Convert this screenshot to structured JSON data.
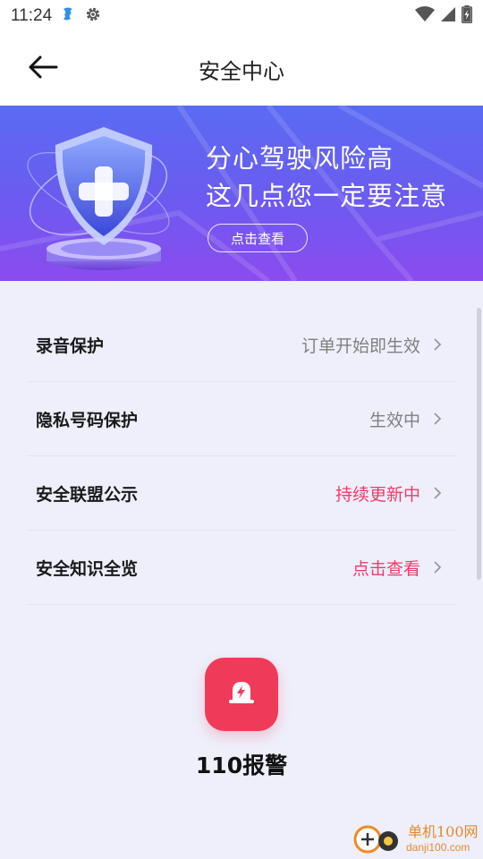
{
  "status_bar": {
    "time": "11:24",
    "icons_left": [
      "notification-app-icon",
      "settings-gear-icon"
    ],
    "icons_right": [
      "wifi-icon",
      "cellular-signal-icon",
      "battery-charging-icon"
    ]
  },
  "header": {
    "title": "安全中心",
    "back_icon": "arrow-left-icon"
  },
  "banner": {
    "line1": "分心驾驶风险高",
    "line2": "这几点您一定要注意",
    "button_label": "点击查看",
    "illustration": "shield-plus-icon",
    "gradient_colors": [
      "#5a6bf3",
      "#8c4bef"
    ]
  },
  "list": {
    "items": [
      {
        "label": "录音保护",
        "value": "订单开始即生效",
        "accent": false
      },
      {
        "label": "隐私号码保护",
        "value": "生效中",
        "accent": false
      },
      {
        "label": "安全联盟公示",
        "value": "持续更新中",
        "accent": true
      },
      {
        "label": "安全知识全览",
        "value": "点击查看",
        "accent": true
      }
    ],
    "accent_color": "#ef3c6a"
  },
  "police": {
    "label": "110报警",
    "icon": "alarm-siren-icon",
    "color": "#f03a5a"
  },
  "watermark": {
    "line1": "单机100网",
    "line2": "danji100.com"
  }
}
